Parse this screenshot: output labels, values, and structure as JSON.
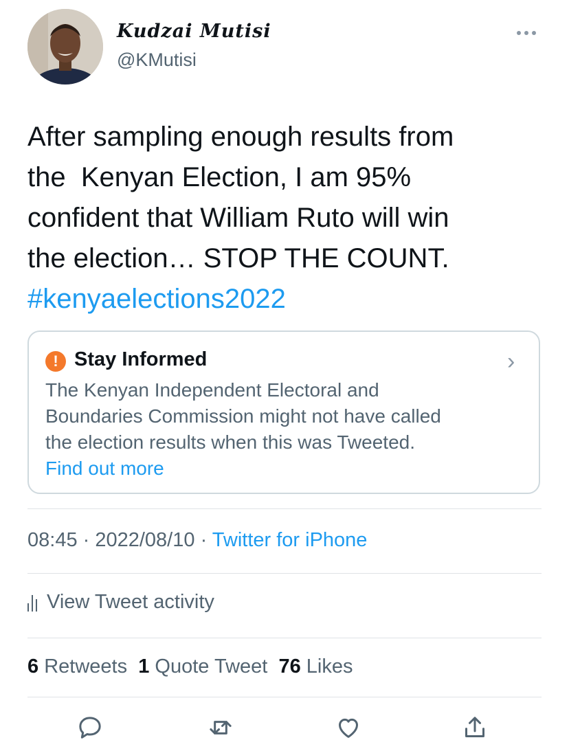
{
  "author": {
    "display_name": "Kudzai Mutisi",
    "handle": "@KMutisi"
  },
  "tweet": {
    "lines": [
      "After sampling enough results from",
      "the  Kenyan Election, I am 95%",
      "confident that William Ruto will win",
      "the election… STOP THE COUNT."
    ],
    "hashtag": "#kenyaelections2022"
  },
  "notice": {
    "title": "Stay Informed",
    "body_lines": [
      "The Kenyan Independent Electoral and",
      "Boundaries Commission might not have called",
      "the election results when this was Tweeted."
    ],
    "link": "Find out more",
    "icon": "exclamation-icon",
    "chevron": "›"
  },
  "meta": {
    "time": "08:45",
    "date": "2022/08/10",
    "separator": " · ",
    "source": "Twitter for iPhone"
  },
  "activity": {
    "label": "View Tweet activity",
    "icon": "bar-chart-icon"
  },
  "stats": {
    "retweets_count": "6",
    "retweets_label": "Retweets",
    "quotes_count": "1",
    "quotes_label": "Quote Tweet",
    "likes_count": "76",
    "likes_label": "Likes"
  },
  "actions": [
    "reply-icon",
    "retweet-icon",
    "like-icon",
    "share-icon"
  ],
  "colors": {
    "link": "#1d9bf0",
    "text": "#0f1419",
    "secondary": "#536471",
    "notice_icon": "#f4792b",
    "border": "#cfd9de"
  }
}
